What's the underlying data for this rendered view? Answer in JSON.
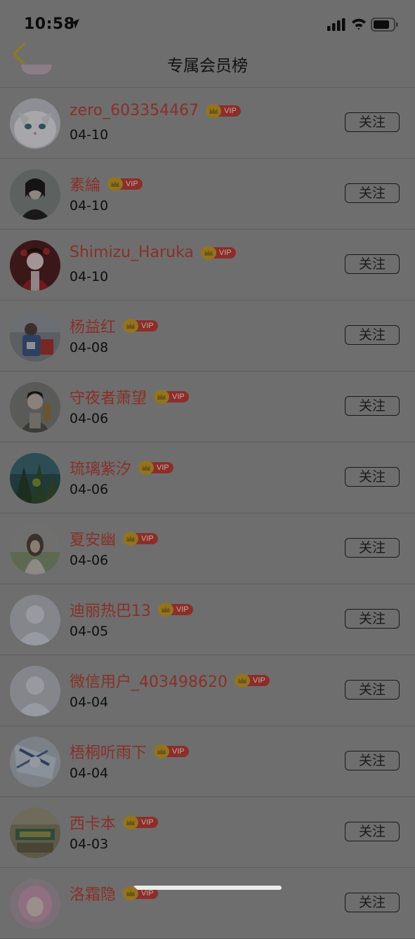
{
  "status_bar": {
    "time": "10:58"
  },
  "nav": {
    "title": "专属会员榜"
  },
  "vip_label": "VIP",
  "follow_label": "关注",
  "members": [
    {
      "name": "zero_603354467",
      "date": "04-10",
      "avatar": "white-cat"
    },
    {
      "name": "素綸",
      "date": "04-10",
      "avatar": "dark-illustration"
    },
    {
      "name": "Shimizu_Haruka",
      "date": "04-10",
      "avatar": "red-kimono-illustration"
    },
    {
      "name": "杨益红",
      "date": "04-08",
      "avatar": "child-photo"
    },
    {
      "name": "守夜者萧望",
      "date": "04-06",
      "avatar": "anime-man"
    },
    {
      "name": "琉璃紫汐",
      "date": "04-06",
      "avatar": "forest-scene"
    },
    {
      "name": "夏安幽",
      "date": "04-06",
      "avatar": "girl-photo"
    },
    {
      "name": "迪丽热巴13",
      "date": "04-05",
      "avatar": "default-user"
    },
    {
      "name": "微信用户_403498620",
      "date": "04-04",
      "avatar": "default-user"
    },
    {
      "name": "梧桐听雨下",
      "date": "04-04",
      "avatar": "blue-sketch"
    },
    {
      "name": "西卡本",
      "date": "04-03",
      "avatar": "poster"
    },
    {
      "name": "洛霜隐",
      "date": "",
      "avatar": "pink-hair"
    }
  ],
  "colors": {
    "overlay_bg": "#6e6e6e",
    "username": "#883028",
    "vip_badge": "#8b2e2a",
    "vip_crown": "#92741f",
    "back_arrow": "#8c7a2a"
  }
}
